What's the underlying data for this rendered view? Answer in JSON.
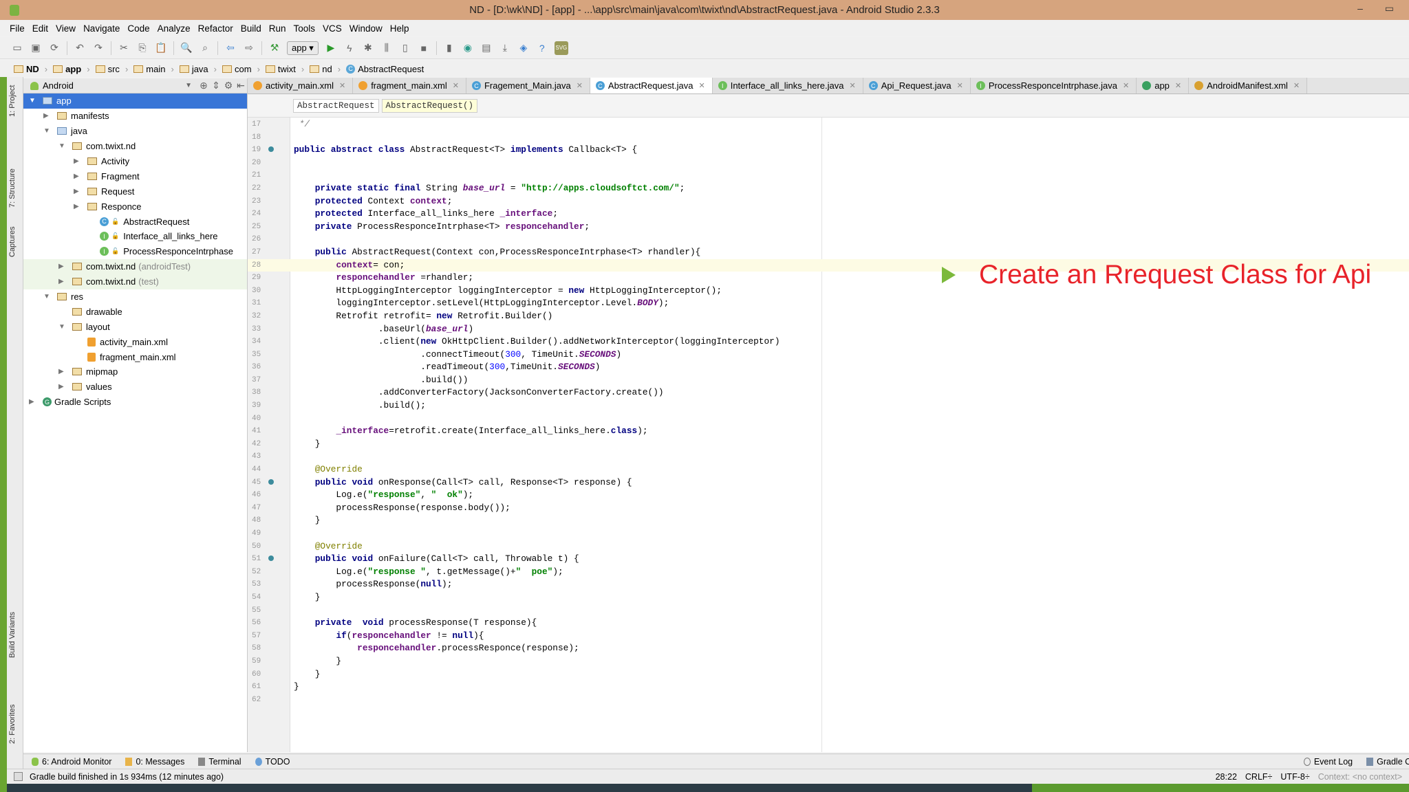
{
  "window": {
    "title": "ND - [D:\\wk\\ND] - [app] - ...\\app\\src\\main\\java\\com\\twixt\\nd\\AbstractRequest.java - Android Studio 2.3.3",
    "controls": "– ▭"
  },
  "menu": [
    "File",
    "Edit",
    "View",
    "Navigate",
    "Code",
    "Analyze",
    "Refactor",
    "Build",
    "Run",
    "Tools",
    "VCS",
    "Window",
    "Help"
  ],
  "toolbar": {
    "run_config": "app ▾",
    "svg_label": "SVG"
  },
  "breadcrumbs": [
    "ND",
    "app",
    "src",
    "main",
    "java",
    "com",
    "twixt",
    "nd",
    "AbstractRequest"
  ],
  "left_strip": [
    "1: Project",
    "7: Structure",
    "Captures",
    "Build Variants",
    "2: Favorites"
  ],
  "project": {
    "view": "Android",
    "tree": [
      {
        "label": "app",
        "level": 0,
        "arrow": "▼",
        "icon": "folder-blue",
        "selected": true
      },
      {
        "label": "manifests",
        "level": 1,
        "arrow": "▶",
        "icon": "folder"
      },
      {
        "label": "java",
        "level": 1,
        "arrow": "▼",
        "icon": "folder-blue"
      },
      {
        "label": "com.twixt.nd",
        "level": 2,
        "arrow": "▼",
        "icon": "folder"
      },
      {
        "label": "Activity",
        "level": 3,
        "arrow": "▶",
        "icon": "folder"
      },
      {
        "label": "Fragment",
        "level": 3,
        "arrow": "▶",
        "icon": "folder"
      },
      {
        "label": "Request",
        "level": 3,
        "arrow": "▶",
        "icon": "folder"
      },
      {
        "label": "Responce",
        "level": 3,
        "arrow": "▶",
        "icon": "folder"
      },
      {
        "label": "AbstractRequest",
        "level": 4,
        "arrow": "",
        "icon": "class"
      },
      {
        "label": "Interface_all_links_here",
        "level": 4,
        "arrow": "",
        "icon": "interface"
      },
      {
        "label": "ProcessResponceIntrphase",
        "level": 4,
        "arrow": "",
        "icon": "interface"
      },
      {
        "label": "com.twixt.nd",
        "suffix": "(androidTest)",
        "level": 2,
        "arrow": "▶",
        "icon": "folder",
        "test": true
      },
      {
        "label": "com.twixt.nd",
        "suffix": "(test)",
        "level": 2,
        "arrow": "▶",
        "icon": "folder",
        "test": true
      },
      {
        "label": "res",
        "level": 1,
        "arrow": "▼",
        "icon": "folder"
      },
      {
        "label": "drawable",
        "level": 2,
        "arrow": "",
        "icon": "folder"
      },
      {
        "label": "layout",
        "level": 2,
        "arrow": "▼",
        "icon": "folder"
      },
      {
        "label": "activity_main.xml",
        "level": 3,
        "arrow": "",
        "icon": "xml"
      },
      {
        "label": "fragment_main.xml",
        "level": 3,
        "arrow": "",
        "icon": "xml"
      },
      {
        "label": "mipmap",
        "level": 2,
        "arrow": "▶",
        "icon": "folder"
      },
      {
        "label": "values",
        "level": 2,
        "arrow": "▶",
        "icon": "folder"
      },
      {
        "label": "Gradle Scripts",
        "level": 0,
        "arrow": "▶",
        "icon": "gradle"
      }
    ]
  },
  "tabs": [
    {
      "label": "activity_main.xml",
      "icon": "xml"
    },
    {
      "label": "fragment_main.xml",
      "icon": "xml"
    },
    {
      "label": "Fragement_Main.java",
      "icon": "class"
    },
    {
      "label": "AbstractRequest.java",
      "icon": "class",
      "active": true
    },
    {
      "label": "Interface_all_links_here.java",
      "icon": "interface"
    },
    {
      "label": "Api_Request.java",
      "icon": "class"
    },
    {
      "label": "ProcessResponceIntrphase.java",
      "icon": "interface"
    },
    {
      "label": "app",
      "icon": "module"
    },
    {
      "label": "AndroidManifest.xml",
      "icon": "manifest"
    }
  ],
  "editor": {
    "breadcrumb": [
      "AbstractRequest",
      "AbstractRequest()"
    ],
    "first_line": 17,
    "caret_line": 28,
    "lines": [
      " */",
      "",
      "public abstract class AbstractRequest<T> implements Callback<T> {",
      "",
      "",
      "    private static final String base_url = \"http://apps.cloudsoftct.com/\";",
      "    protected Context context;",
      "    protected Interface_all_links_here _interface;",
      "    private ProcessResponceIntrphase<T> responcehandler;",
      "",
      "    public AbstractRequest(Context con,ProcessResponceIntrphase<T> rhandler){",
      "        context= con;",
      "        responcehandler =rhandler;",
      "        HttpLoggingInterceptor loggingInterceptor = new HttpLoggingInterceptor();",
      "        loggingInterceptor.setLevel(HttpLoggingInterceptor.Level.BODY);",
      "        Retrofit retrofit= new Retrofit.Builder()",
      "                .baseUrl(base_url)",
      "                .client(new OkHttpClient.Builder().addNetworkInterceptor(loggingInterceptor)",
      "                        .connectTimeout(300, TimeUnit.SECONDS)",
      "                        .readTimeout(300,TimeUnit.SECONDS)",
      "                        .build())",
      "                .addConverterFactory(JacksonConverterFactory.create())",
      "                .build();",
      "",
      "        _interface=retrofit.create(Interface_all_links_here.class);",
      "    }",
      "",
      "    @Override",
      "    public void onResponse(Call<T> call, Response<T> response) {",
      "        Log.e(\"response\", \"  ok\");",
      "        processResponse(response.body());",
      "    }",
      "",
      "    @Override",
      "    public void onFailure(Call<T> call, Throwable t) {",
      "        Log.e(\"response \", t.getMessage()+\"  poe\");",
      "        processResponse(null);",
      "    }",
      "",
      "    private  void processResponse(T response){",
      "        if(responcehandler != null){",
      "            responcehandler.processResponce(response);",
      "        }",
      "    }",
      "}",
      ""
    ]
  },
  "annotation": "Create an Rrequest Class for Api",
  "tool_windows": [
    "6: Android Monitor",
    "0: Messages",
    "Terminal",
    "TODO"
  ],
  "tool_windows_right": [
    "Event Log",
    "Gradle Console"
  ],
  "status": {
    "message": "Gradle build finished in 1s 934ms (12 minutes ago)",
    "position": "28:22",
    "line_sep": "CRLF÷",
    "encoding": "UTF-8÷",
    "context": "Context: <no context>"
  },
  "colors": {
    "accent": "#3875d7",
    "annotation": "#e8232a",
    "pointer": "#7cb93b",
    "titlebar": "#d6a47e"
  }
}
